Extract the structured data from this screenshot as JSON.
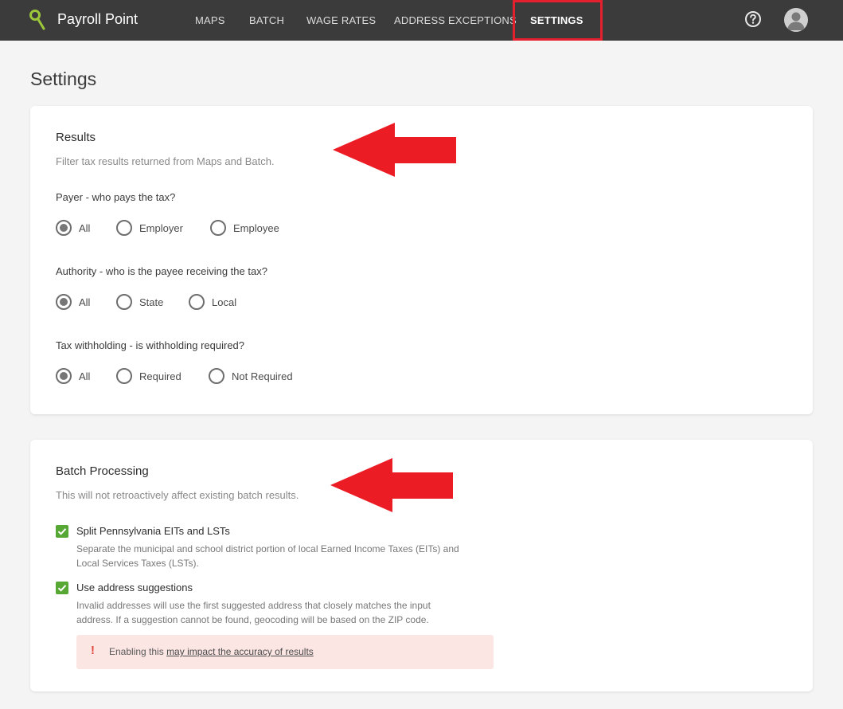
{
  "header": {
    "brand": "Payroll Point",
    "nav": [
      "MAPS",
      "BATCH",
      "WAGE RATES",
      "ADDRESS EXCEPTIONS",
      "SETTINGS"
    ]
  },
  "page": {
    "title": "Settings"
  },
  "results": {
    "title": "Results",
    "subtitle": "Filter tax results returned from Maps and Batch.",
    "payer": {
      "label": "Payer - who pays the tax?",
      "options": [
        "All",
        "Employer",
        "Employee"
      ],
      "selected": "All"
    },
    "authority": {
      "label": "Authority - who is the payee receiving the tax?",
      "options": [
        "All",
        "State",
        "Local"
      ],
      "selected": "All"
    },
    "withholding": {
      "label": "Tax withholding - is withholding required?",
      "options": [
        "All",
        "Required",
        "Not Required"
      ],
      "selected": "All"
    }
  },
  "batch": {
    "title": "Batch Processing",
    "subtitle": "This will not retroactively affect existing batch results.",
    "split": {
      "label": "Split Pennsylvania EITs and LSTs",
      "desc_1": "Separate the municipal and school district portion of local Earned Income Taxes (EITs) and",
      "desc_2": "Local Services Taxes (LSTs).",
      "checked": true
    },
    "suggest": {
      "label": "Use address suggestions",
      "desc_1": "Invalid addresses will use the first suggested address that closely matches the input",
      "desc_2": "address. If a suggestion cannot be found, geocoding will be based on the ZIP code.",
      "checked": true
    },
    "warning": {
      "icon": "!",
      "prefix": "Enabling this",
      "link": "may impact the accuracy of results"
    }
  },
  "colors": {
    "topbar": "#3b3b3b",
    "accent_green": "#57a735",
    "highlight_red": "#e5202e",
    "warning_bg": "#fbe6e4"
  }
}
